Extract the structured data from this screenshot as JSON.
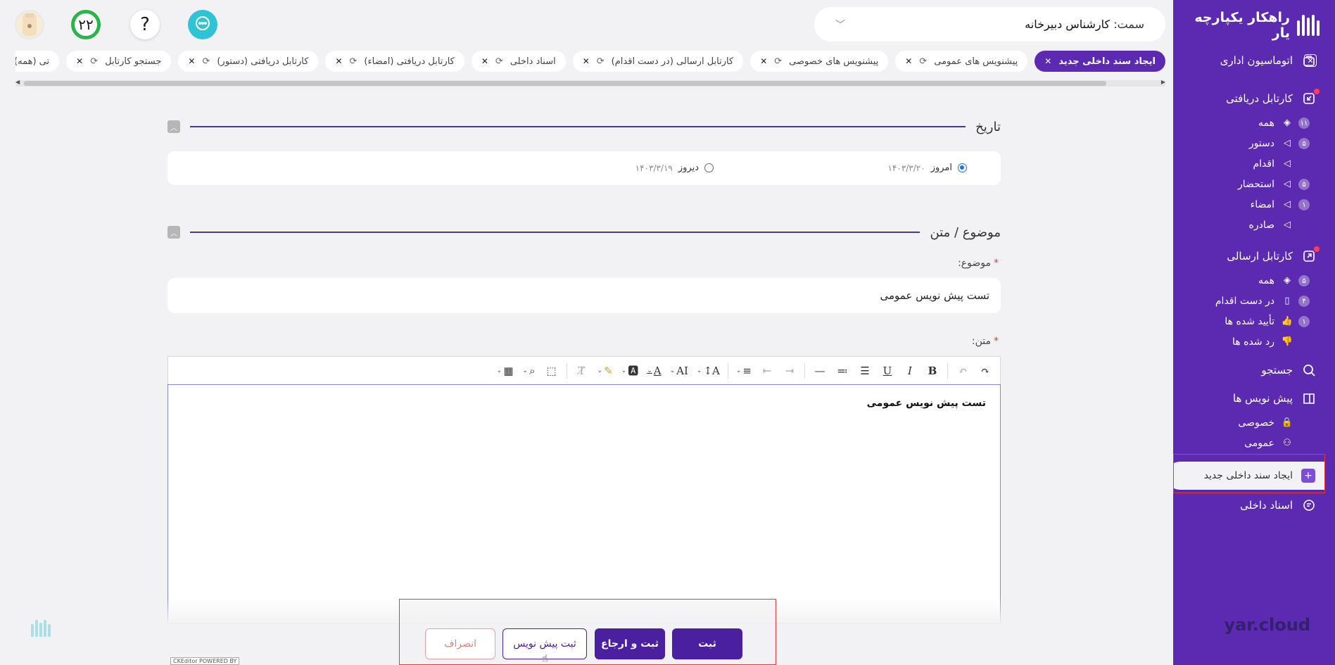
{
  "app": {
    "brand_name": "راهکار یکپارچه یار",
    "footer_brand": "yar.cloud",
    "accent_color": "#5b2ab0"
  },
  "topbar": {
    "score": "۲۲",
    "help_label": "?",
    "role_label": "سمت:",
    "role_value": "کارشناس دبیرخانه"
  },
  "tabs": [
    {
      "label": "ایجاد سند داخلی جدید",
      "active": true,
      "refresh": false
    },
    {
      "label": "پیشنویس های عمومی",
      "active": false,
      "refresh": true
    },
    {
      "label": "پیشنویس های خصوصی",
      "active": false,
      "refresh": true
    },
    {
      "label": "کارتابل ارسالی (در دست اقدام)",
      "active": false,
      "refresh": true
    },
    {
      "label": "اسناد داخلی",
      "active": false,
      "refresh": true
    },
    {
      "label": "کارتابل دریافتی (امضاء)",
      "active": false,
      "refresh": true
    },
    {
      "label": "کارتابل دریافتی (دستور)",
      "active": false,
      "refresh": true
    },
    {
      "label": "جستجو کارتابل",
      "active": false,
      "refresh": true
    },
    {
      "label": "تی (همه)",
      "active": false,
      "refresh": true
    }
  ],
  "sidebar": {
    "automation": "اتوماسیون اداری",
    "inbox": {
      "label": "کارتابل دریافتی",
      "items": [
        {
          "label": "همه",
          "count": "۱۱",
          "icon": "layers-icon"
        },
        {
          "label": "دستور",
          "count": "۵",
          "icon": "triangle-left-icon"
        },
        {
          "label": "اقدام",
          "count": "",
          "icon": "triangle-left-icon"
        },
        {
          "label": "استحضار",
          "count": "۵",
          "icon": "triangle-left-icon"
        },
        {
          "label": "امضاء",
          "count": "۱",
          "icon": "triangle-left-icon"
        },
        {
          "label": "صادره",
          "count": "",
          "icon": "triangle-left-icon"
        }
      ]
    },
    "outbox": {
      "label": "کارتابل ارسالی",
      "items": [
        {
          "label": "همه",
          "count": "۵",
          "icon": "layers-icon"
        },
        {
          "label": "در دست اقدام",
          "count": "۴",
          "icon": "map-icon"
        },
        {
          "label": "تأیید شده ها",
          "count": "۱",
          "icon": "thumbs-up-icon"
        },
        {
          "label": "رد شده ها",
          "count": "",
          "icon": "thumbs-down-icon"
        }
      ]
    },
    "search": "جستجو",
    "drafts": {
      "label": "پیش نویس ها",
      "items": [
        {
          "label": "خصوصی",
          "icon": "lock-icon"
        },
        {
          "label": "عمومی",
          "icon": "users-icon"
        }
      ]
    },
    "new_internal": "ایجاد سند داخلی جدید",
    "internal_docs": "اسناد داخلی"
  },
  "form": {
    "date_section": "تاریخ",
    "today_label": "امروز",
    "today_value": "۱۴۰۳/۳/۲۰",
    "yesterday_label": "دیروز",
    "yesterday_value": "۱۴۰۳/۳/۱۹",
    "subject_section": "موضوع / متن",
    "subject_label": "موضوع:",
    "subject_value": "تست پیش نویس عمومی",
    "body_label": "متن:",
    "body_value": "تست پیش نویس عمومی",
    "editor_badge": "CKEditor POWERED BY"
  },
  "actions": {
    "submit": "ثبت",
    "submit_refer": "ثبت و ارجاع",
    "save_draft": "ثبت پیش نویس",
    "cancel": "انصراف"
  }
}
